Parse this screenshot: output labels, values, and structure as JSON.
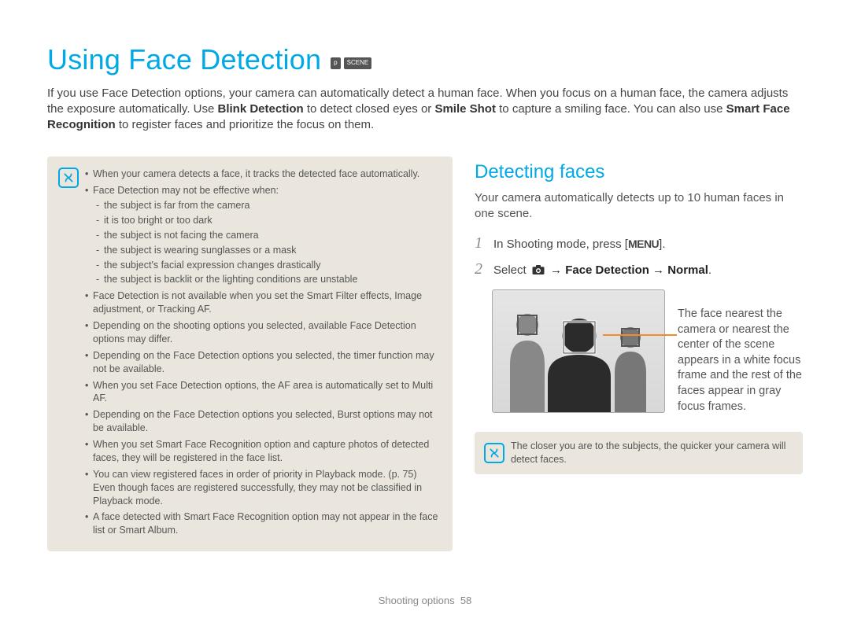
{
  "title": "Using Face Detection",
  "mode_badges": [
    "p",
    "SCENE"
  ],
  "intro_html": "If you use Face Detection options, your camera can automatically detect a human face. When you focus on a human face, the camera adjusts the exposure automatically. Use <b>Blink Detection</b> to detect closed eyes or <b>Smile Shot</b> to capture a smiling face. You can also use <b>Smart Face Recognition</b> to register faces and prioritize the focus on them.",
  "notes": [
    {
      "text": "When your camera detects a face, it tracks the detected face automatically."
    },
    {
      "text": "Face Detection may not be effective when:",
      "sub": [
        "the subject is far from the camera",
        "it is too bright or too dark",
        "the subject is not facing the camera",
        "the subject is wearing sunglasses or a mask",
        "the subject's facial expression changes drastically",
        "the subject is backlit or the lighting conditions are unstable"
      ]
    },
    {
      "text": "Face Detection is not available when you set the Smart Filter effects, Image adjustment, or Tracking AF."
    },
    {
      "text": "Depending on the shooting options you selected, available Face Detection options may differ."
    },
    {
      "text": "Depending on the Face Detection options you selected, the timer function may not be available."
    },
    {
      "text": "When you set Face Detection options, the AF area is automatically set to Multi AF."
    },
    {
      "text": "Depending on the Face Detection options you selected, Burst options may not be available."
    },
    {
      "text": "When you set Smart Face Recognition option and capture photos of detected faces, they will be registered in the face list."
    },
    {
      "text": "You can view registered faces in order of priority in Playback mode. (p. 75) Even though faces are registered successfully, they may not be classified in Playback mode."
    },
    {
      "text": "A face detected with Smart Face Recognition option may not appear in the face list or Smart Album."
    }
  ],
  "section": {
    "heading": "Detecting faces",
    "intro": "Your camera automatically detects up to 10 human faces in one scene.",
    "steps": [
      {
        "num": "1",
        "pre": "In Shooting mode, press [",
        "menu": "MENU",
        "post": "]."
      },
      {
        "num": "2",
        "pre": "Select ",
        "bold": " → Face Detection → Normal",
        "trailing": "."
      }
    ],
    "demo_caption": "The face nearest the camera or nearest the center of the scene appears in a white focus frame and the rest of the faces appear in gray focus frames.",
    "tip": "The closer you are to the subjects, the quicker your camera will detect faces."
  },
  "footer": {
    "section": "Shooting options",
    "page": "58"
  }
}
